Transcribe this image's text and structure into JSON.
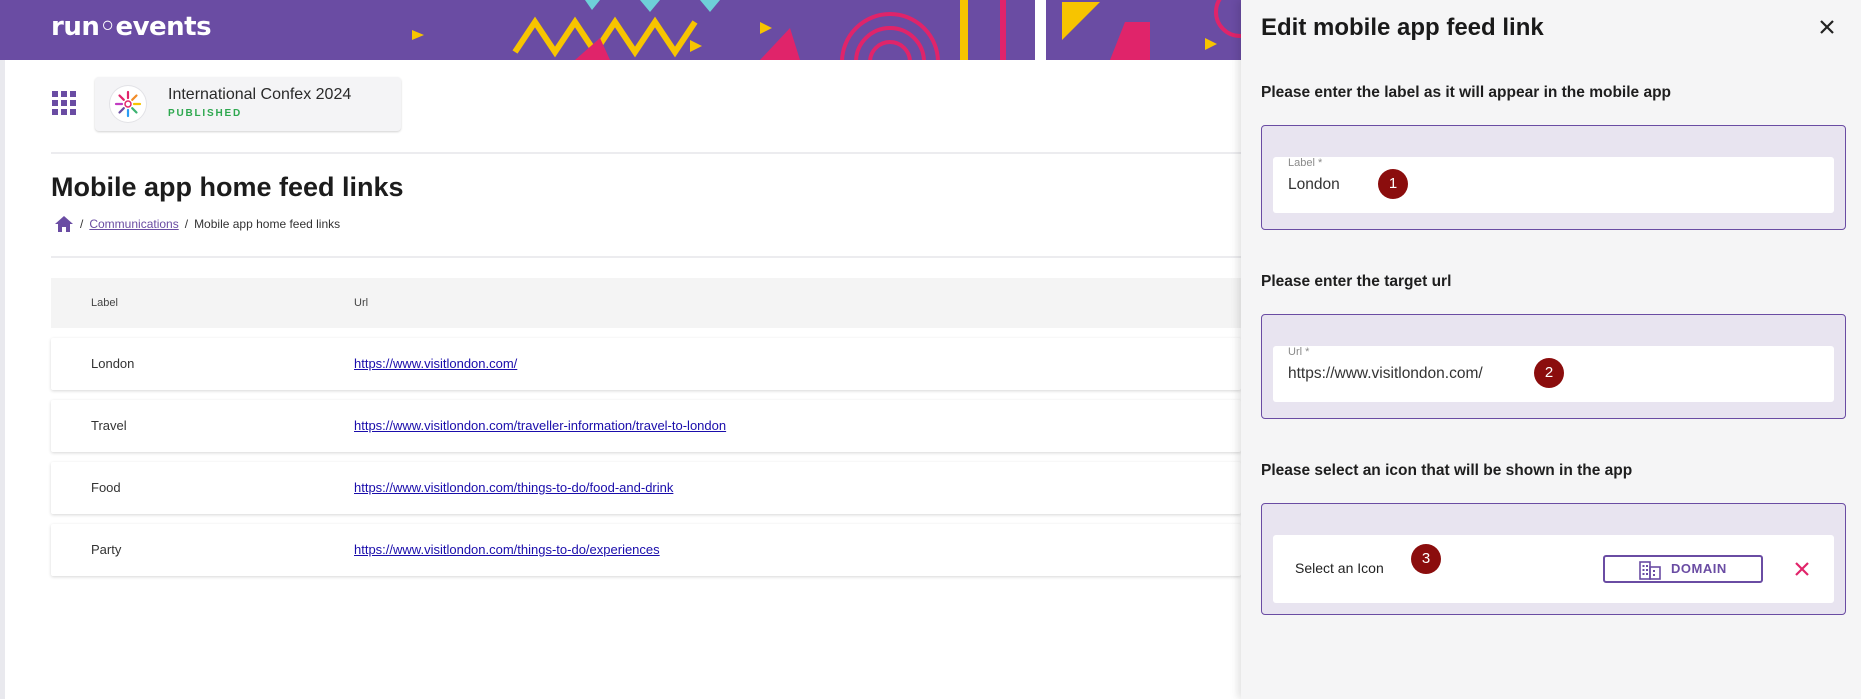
{
  "brand": {
    "logo_text": "run◦events",
    "accent": "#6a4ca3"
  },
  "event": {
    "name": "International Confex 2024",
    "status": "PUBLISHED",
    "status_color": "#2ea84f"
  },
  "page": {
    "title": "Mobile app home feed links",
    "breadcrumb": {
      "link": "Communications",
      "current": "Mobile app home feed links",
      "separator": "/"
    }
  },
  "table": {
    "headers": {
      "label": "Label",
      "url": "Url"
    },
    "rows": [
      {
        "label": "London",
        "url": "https://www.visitlondon.com/"
      },
      {
        "label": "Travel",
        "url": "https://www.visitlondon.com/traveller-information/travel-to-london"
      },
      {
        "label": "Food",
        "url": "https://www.visitlondon.com/things-to-do/food-and-drink"
      },
      {
        "label": "Party",
        "url": "https://www.visitlondon.com/things-to-do/experiences"
      }
    ]
  },
  "drawer": {
    "title": "Edit mobile app feed link",
    "close_icon": "close-icon",
    "label_section": {
      "heading": "Please enter the label as it will appear in the mobile app",
      "field_label": "Label *",
      "value": "London",
      "marker": "1"
    },
    "url_section": {
      "heading": "Please enter the target url",
      "field_label": "Url *",
      "value": "https://www.visitlondon.com/",
      "marker": "2"
    },
    "icon_section": {
      "heading": "Please select an icon that will be shown in the app",
      "row_label": "Select an Icon",
      "selected_icon": "DOMAIN",
      "selected_icon_name": "domain-icon",
      "marker": "3"
    }
  }
}
